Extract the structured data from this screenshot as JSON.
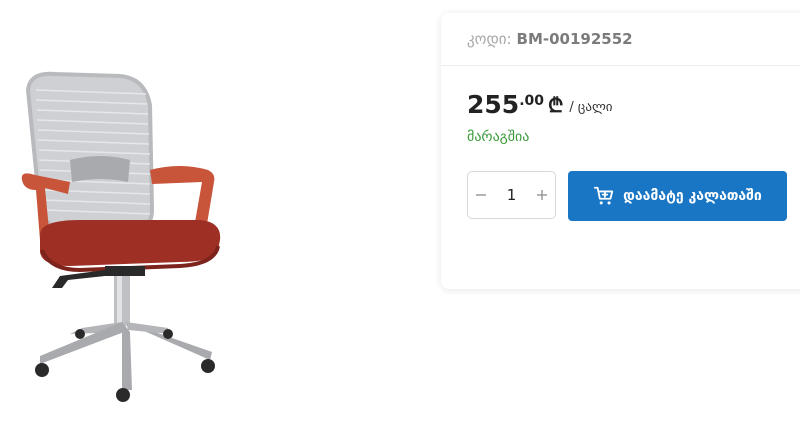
{
  "product": {
    "code_label": "კოდი:",
    "code_value": "BM-00192552",
    "price_main": "255",
    "price_cents": ".00",
    "currency_symbol": "₾",
    "unit": "/ ცალი",
    "stock_status": "მარაგშია",
    "stock_color": "#3b9b3b",
    "quantity": "1",
    "add_to_cart_label": "დაამატე კალათაში",
    "accent_color": "#1976c5"
  },
  "icons": {
    "minus": "minus-icon",
    "plus": "plus-icon",
    "cart": "cart-icon"
  }
}
